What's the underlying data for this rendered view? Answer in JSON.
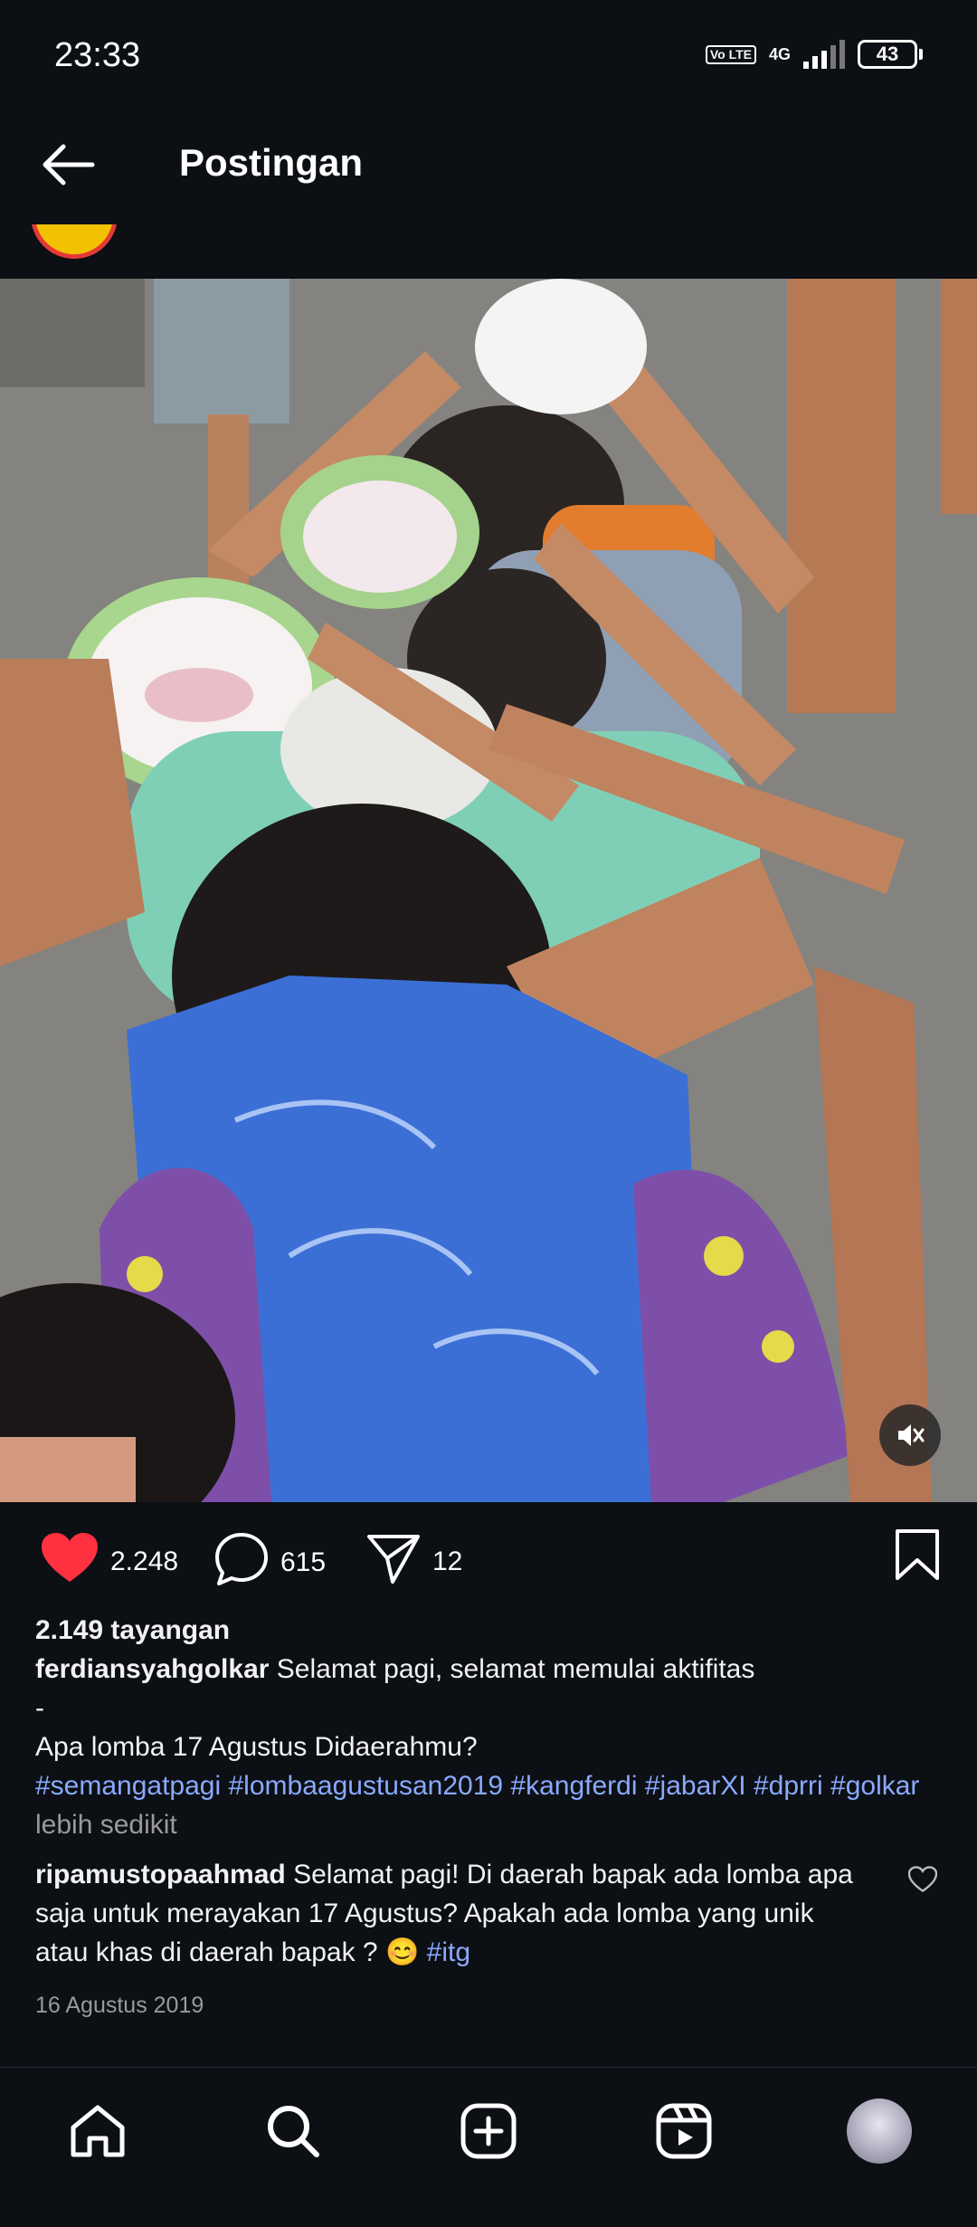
{
  "status_bar": {
    "time": "23:33",
    "volte": "Vo LTE",
    "network": "4G",
    "battery": "43"
  },
  "header": {
    "title": "Postingan",
    "back_icon": "arrow-left-icon"
  },
  "post": {
    "likes": "2.248",
    "comments": "615",
    "shares": "12",
    "views": "2.149 tayangan",
    "username": "ferdiansyahgolkar",
    "caption_line1": "Selamat pagi, selamat memulai aktifitas",
    "caption_dash": "-",
    "caption_question": "Apa lomba 17 Agustus Didaerahmu?",
    "hashtags": [
      "#semangatpagi",
      "#lombaagustusan2019",
      "#kangferdi",
      "#jabarXI",
      "#dprri",
      "#golkar"
    ],
    "more_label": "lebih sedikit",
    "date": "16 Agustus 2019"
  },
  "comment": {
    "username": "ripamustopaahmad",
    "text": "Selamat pagi! Di daerah bapak ada lomba apa saja untuk merayakan 17 Agustus? Apakah ada lomba yang unik atau khas di daerah bapak ? 😊",
    "hashtag": "#itg"
  },
  "nav": {
    "items": [
      "home-icon",
      "search-icon",
      "add-post-icon",
      "reels-icon",
      "profile-avatar"
    ]
  },
  "colors": {
    "background": "#0c0f14",
    "like": "#ff3040",
    "hashtag": "#8aa9ff",
    "muted_text": "#9a9a9a"
  }
}
